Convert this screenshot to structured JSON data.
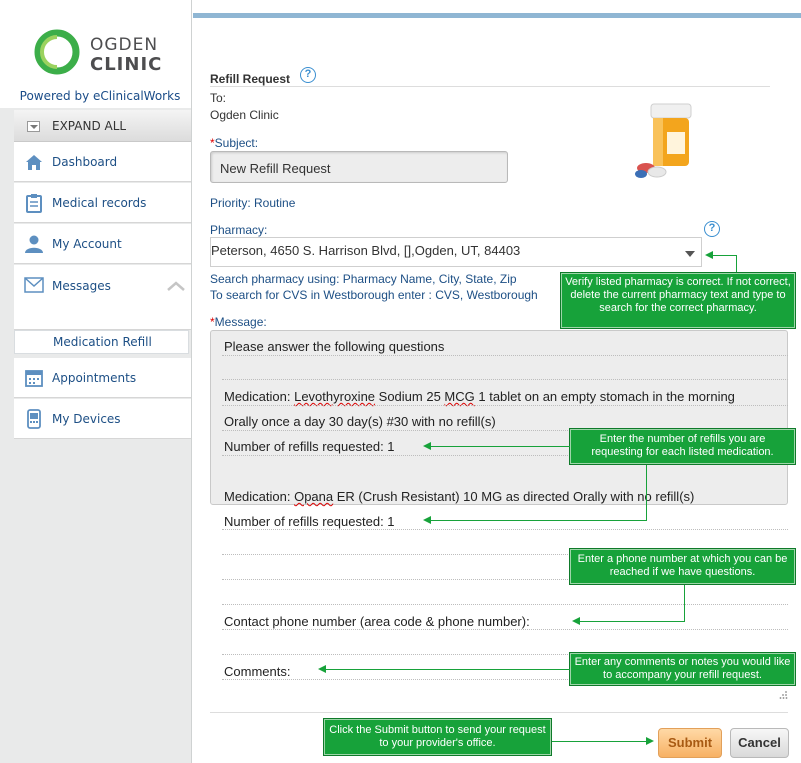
{
  "brand": {
    "line1": "OGDEN",
    "line2": "CLINIC",
    "powered_by": "Powered by eClinicalWorks",
    "ring_color": "#3cae49"
  },
  "sidebar": {
    "expand_all": "EXPAND ALL",
    "items": [
      {
        "label": "Dashboard",
        "icon": "home-icon"
      },
      {
        "label": "Medical records",
        "icon": "clipboard-icon"
      },
      {
        "label": "My Account",
        "icon": "user-icon"
      },
      {
        "label": "Messages",
        "icon": "envelope-icon"
      },
      {
        "label": "Appointments",
        "icon": "calendar-icon"
      },
      {
        "label": "My Devices",
        "icon": "device-icon"
      }
    ],
    "sub_item": "Medication Refill"
  },
  "form": {
    "title": "Refill Request",
    "to_label": "To:",
    "to_value": "Ogden Clinic",
    "subject_required": "*",
    "subject_label": "Subject:",
    "subject_value": "New Refill Request",
    "priority": "Priority: Routine",
    "pharmacy_label": "Pharmacy:",
    "pharmacy_value": "Peterson, 4650 S. Harrison Blvd, [],Ogden, UT, 84403",
    "search_hint_1": "Search pharmacy using: Pharmacy Name, City, State, Zip",
    "search_hint_2": "To search for CVS in Westborough enter : CVS, Westborough",
    "message_required": "*",
    "message_label": "Message:"
  },
  "message": {
    "intro": "Please answer the following questions",
    "med1_prefix": "Medication:  ",
    "med1_name_a": "Levothyroxine",
    "med1_name_b": " Sodium 25 ",
    "med1_name_c": "MCG",
    "med1_rest": " 1 tablet on an empty stomach in the morning",
    "med1_sig": "Orally once a day 30 day(s) #30 with no refill(s)",
    "refills_1": "Number of refills requested: 1",
    "med2_prefix": "Medication:  ",
    "med2_name": "Opana",
    "med2_rest": " ER (Crush Resistant) 10 MG as directed  Orally   with no refill(s)",
    "refills_2": "Number of refills requested: 1",
    "contact": "Contact phone number (area code & phone number):",
    "comments": "Comments:"
  },
  "callouts": {
    "pharmacy": "Verify listed pharmacy is correct. If not correct, delete the current pharmacy text and type to search for the correct pharmacy.",
    "refills": "Enter the number of refills you are requesting for each listed medication.",
    "phone": "Enter a phone number at which you can be reached if we have questions.",
    "comments": "Enter any comments or notes you would like to accompany your refill request.",
    "submit": "Click the Submit button to send your request to your provider's office."
  },
  "buttons": {
    "submit": "Submit",
    "cancel": "Cancel"
  },
  "help_glyph": "?"
}
